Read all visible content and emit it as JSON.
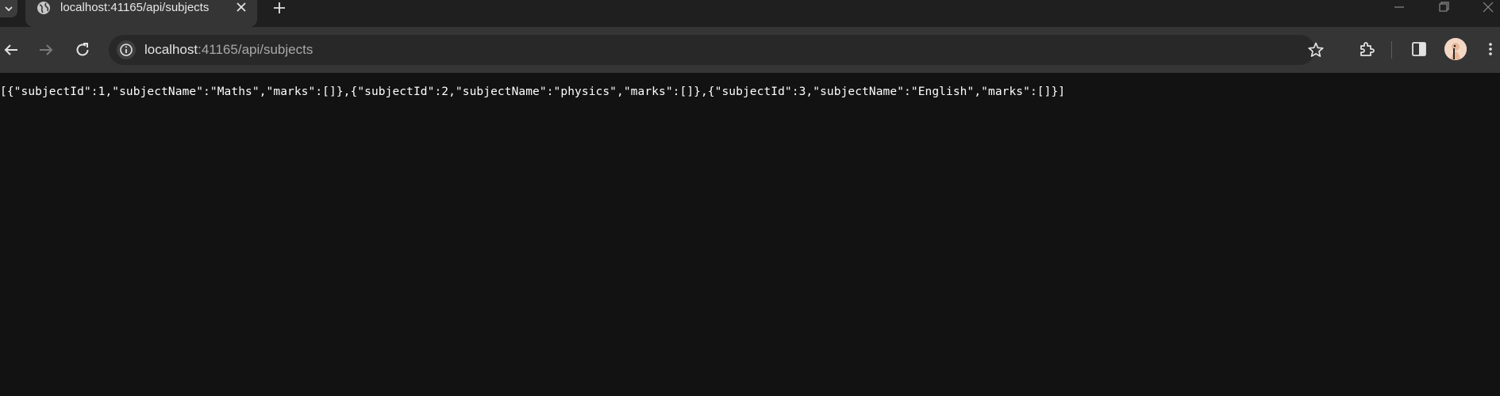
{
  "browser": {
    "tab": {
      "title": "localhost:41165/api/subjects"
    },
    "address_bar": {
      "host": "localhost",
      "rest": ":41165/api/subjects"
    }
  },
  "page": {
    "json_text": "[{\"subjectId\":1,\"subjectName\":\"Maths\",\"marks\":[]},{\"subjectId\":2,\"subjectName\":\"physics\",\"marks\":[]},{\"subjectId\":3,\"subjectName\":\"English\",\"marks\":[]}]"
  },
  "colors": {
    "background": "#121212",
    "toolbar": "#353535",
    "tabstrip": "#1f1f1f",
    "omnibox": "#282828"
  }
}
